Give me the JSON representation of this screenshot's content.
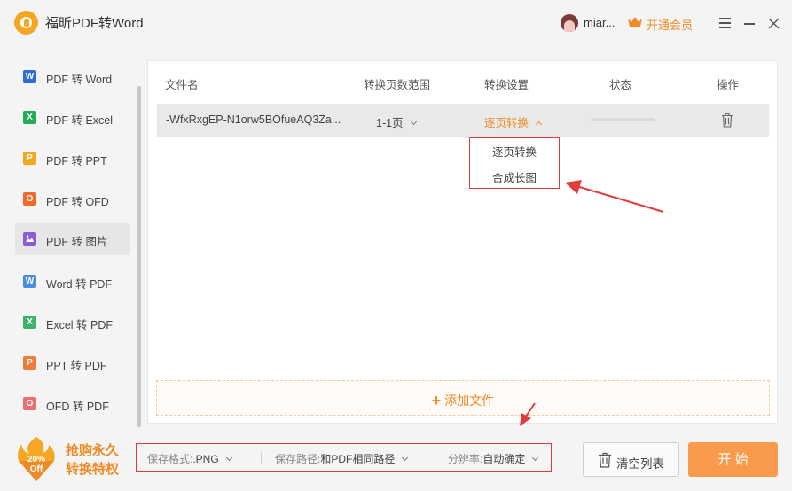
{
  "app": {
    "title": "福昕PDF转Word",
    "username": "miar...",
    "vip_label": "开通会员"
  },
  "sidebar": {
    "items": [
      {
        "label": "PDF 转 Word",
        "icon": "W",
        "color": "#2b6fd6"
      },
      {
        "label": "PDF 转 Excel",
        "icon": "X",
        "color": "#1fae54"
      },
      {
        "label": "PDF 转 PPT",
        "icon": "P",
        "color": "#f5a623"
      },
      {
        "label": "PDF 转 OFD",
        "icon": "O",
        "color": "#ef6a2c"
      },
      {
        "label": "PDF 转 图片",
        "icon": "img",
        "color": "#8e5bd6"
      },
      {
        "label": "Word 转 PDF",
        "icon": "W",
        "color": "#4a8de0"
      },
      {
        "label": "Excel 转 PDF",
        "icon": "X",
        "color": "#3bb46a"
      },
      {
        "label": "PPT 转 PDF",
        "icon": "P",
        "color": "#ef7d3a"
      },
      {
        "label": "OFD 转 PDF",
        "icon": "O",
        "color": "#ec6e6e"
      }
    ],
    "active_index": 4
  },
  "table": {
    "headers": [
      "文件名",
      "转换页数范围",
      "转换设置",
      "状态",
      "操作"
    ],
    "rows": [
      {
        "filename": "-WfxRxgEP-N1orw5BOfueAQ3Za...",
        "page_range": "1-1页",
        "setting": "逐页转换",
        "progress": 0
      }
    ]
  },
  "dropdown": {
    "options": [
      "逐页转换",
      "合成长图"
    ]
  },
  "add_file_label": "添加文件",
  "promo": {
    "badge_percent": "20%",
    "badge_off": "Off",
    "line1": "抢购永久",
    "line2": "转换特权"
  },
  "settings": {
    "format_label": "保存格式:",
    "format_value": ".PNG",
    "path_label": "保存路径:",
    "path_value": "和PDF相同路径",
    "resolution_label": "分辨率:",
    "resolution_value": "自动确定"
  },
  "buttons": {
    "clear": "清空列表",
    "start": "开 始"
  },
  "colors": {
    "accent": "#f08a24",
    "highlight_box": "#e03c3c",
    "start_button": "#f99a4c"
  }
}
